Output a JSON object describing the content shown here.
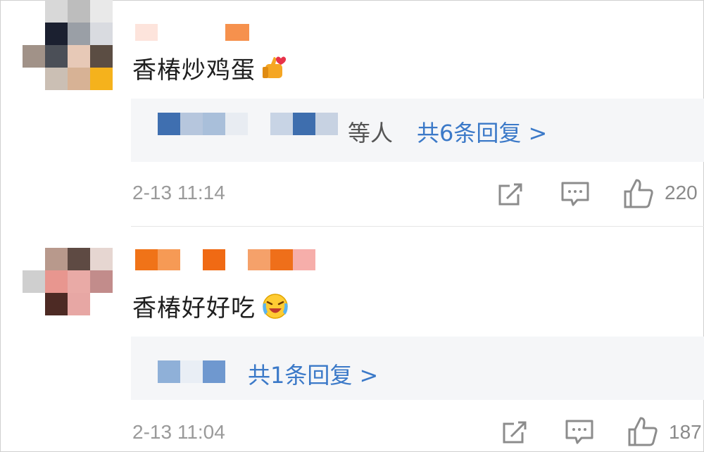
{
  "comments": [
    {
      "text": "香椿炒鸡蛋",
      "emoji": "thumbs-up-heart-emoji",
      "reply_prefix": "等人",
      "reply_link": "共6条回复 >",
      "time": "2-13 11:14",
      "like_count": "220"
    },
    {
      "text": "香椿好好吃",
      "emoji": "laughing-crying-emoji",
      "reply_link": "共1条回复 >",
      "time": "2-13 11:04",
      "like_count": "187"
    }
  ],
  "colors": {
    "link_blue": "#3b79c8",
    "username_orange": "#f07a2a",
    "reply_bg": "#f5f6f8"
  }
}
